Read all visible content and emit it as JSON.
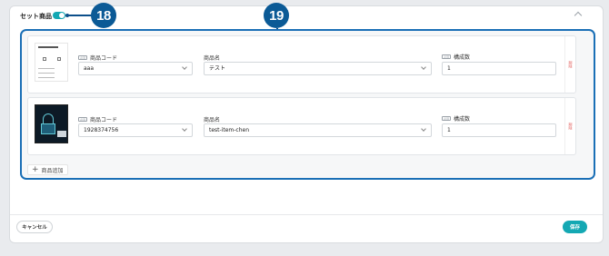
{
  "section": {
    "title": "セット商品",
    "toggle_on": true,
    "accent": "#14a8b3"
  },
  "annotations": {
    "badge_a": "18",
    "badge_b": "19",
    "color": "#0b5a96"
  },
  "labels": {
    "product_code": "商品コード",
    "product_name": "商品名",
    "quantity": "構成数",
    "required_tag": "必須",
    "delete": "削除"
  },
  "rows": [
    {
      "product_code": "aaa",
      "product_name": "テスト",
      "quantity": "1",
      "thumb_style": "light"
    },
    {
      "product_code": "1928374756",
      "product_name": "test-item-chen",
      "quantity": "1",
      "thumb_style": "dark"
    }
  ],
  "add_button": "商品追加",
  "footer": {
    "cancel": "キャンセル",
    "save": "保存"
  }
}
